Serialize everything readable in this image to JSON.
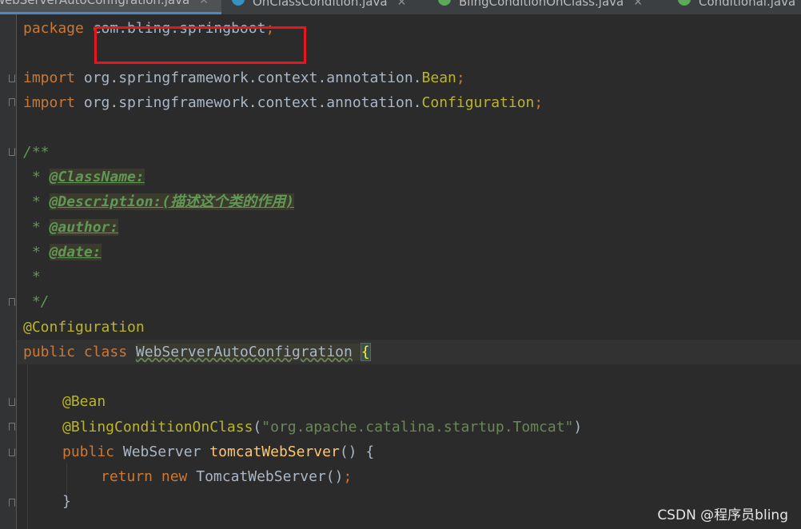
{
  "tabs": [
    {
      "label": "WebServerAutoConfigration.java",
      "active": true,
      "icon": "class-icon"
    },
    {
      "label": "OnClassCondition.java",
      "active": false,
      "icon": "class-icon"
    },
    {
      "label": "BlingConditionOnClass.java",
      "active": false,
      "icon": "annotation-icon"
    },
    {
      "label": "Conditional.java",
      "active": false,
      "icon": "annotation-icon"
    }
  ],
  "code": {
    "package_kw": "package",
    "package_name": "com.bling.springboot",
    "semicolon": ";",
    "import_kw": "import",
    "import1_path": "org.springframework.context.annotation.",
    "import1_class": "Bean",
    "import2_path": "org.springframework.context.annotation.",
    "import2_class": "Configuration",
    "doc_open": "/**",
    "doc_star": " * ",
    "doc_classname": "@ClassName:",
    "doc_description": "@Description:(描述这个类的作用)",
    "doc_author": "@author:",
    "doc_date": "@date:",
    "doc_empty": " *",
    "doc_close": " */",
    "annotation_configuration": "@Configuration",
    "public_kw": "public",
    "class_kw": "class",
    "class_name": "WebServerAutoConfigration",
    "open_brace": "{",
    "annotation_bean": "@Bean",
    "annotation_bling": "@BlingConditionOnClass",
    "bling_arg": "\"org.apache.catalina.startup.Tomcat\"",
    "paren_open": "(",
    "paren_close": ")",
    "return_type": "WebServer",
    "method_name": "tomcatWebServer",
    "method_parens": "()",
    "method_brace": " {",
    "return_kw": "return",
    "new_kw": "new",
    "ctor_call": "TomcatWebServer()",
    "close_brace": "}"
  },
  "watermark": "CSDN @程序员bling",
  "colors": {
    "keyword": "#cc7832",
    "annotation": "#bbb529",
    "string": "#6a8759",
    "comment": "#629755",
    "method": "#ffc66d",
    "highlight_box": "#e8161c"
  }
}
